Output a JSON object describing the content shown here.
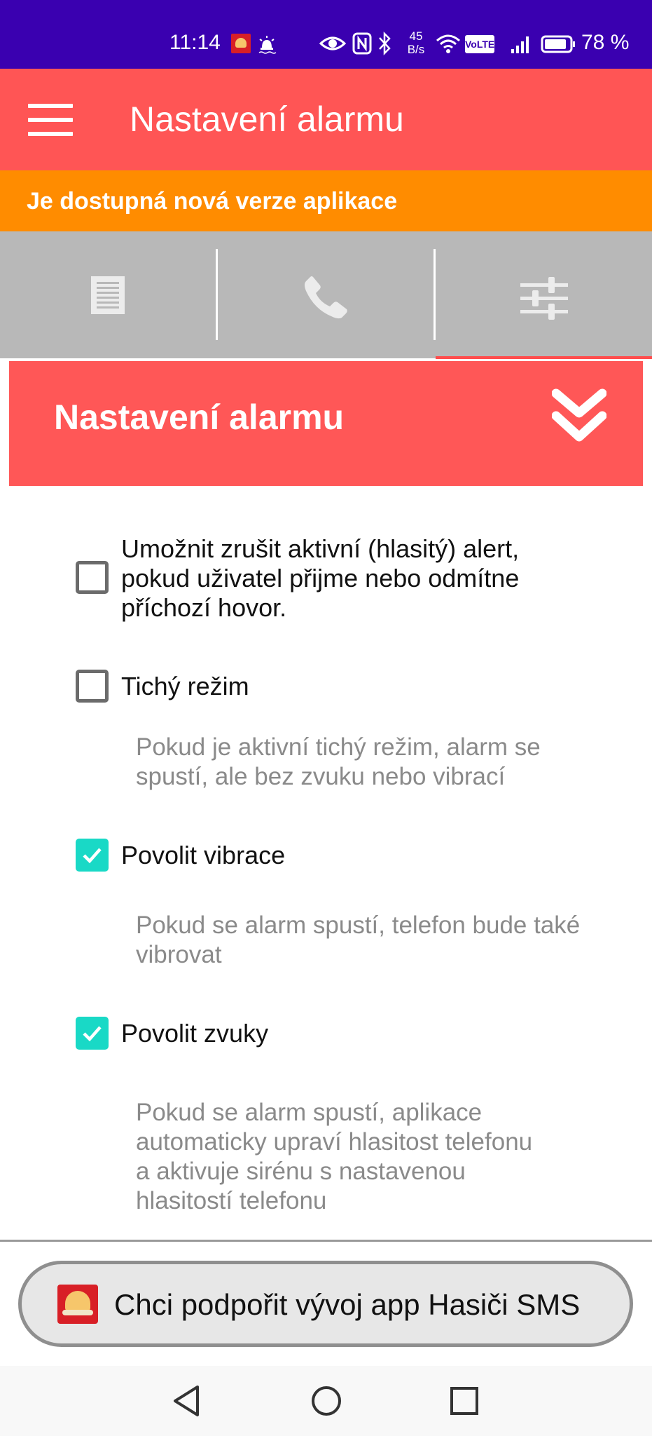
{
  "status_bar": {
    "time": "11:14",
    "net_speed_value": "45",
    "net_speed_unit": "B/s",
    "volte": "VoLTE",
    "battery_percent": "78 %",
    "icons": [
      "app-notification-icon",
      "alarm-icon",
      "eye-icon",
      "nfc-icon",
      "bluetooth-icon",
      "wifi-icon",
      "volte-icon",
      "signal-icon",
      "battery-icon"
    ]
  },
  "app_bar": {
    "title": "Nastavení alarmu",
    "menu_icon": "hamburger-menu-icon"
  },
  "update_banner": {
    "text": "Je dostupná nová verze aplikace"
  },
  "tabs": [
    {
      "icon": "list-icon",
      "selected": false
    },
    {
      "icon": "phone-icon",
      "selected": false
    },
    {
      "icon": "sliders-icon",
      "selected": true
    }
  ],
  "section": {
    "title": "Nastavení alarmu",
    "toggle_icon": "double-chevron-down-icon"
  },
  "settings": [
    {
      "label_lines": [
        "Umožnit zrušit aktivní (hlasitý) alert,",
        "pokud uživatel přijme nebo odmítne",
        "příchozí hovor."
      ],
      "checked": false
    },
    {
      "label": "Tichý režim",
      "description_lines": [
        "Pokud je aktivní tichý režim, alarm se",
        "spustí, ale bez zvuku nebo vibrací"
      ],
      "checked": false
    },
    {
      "label": "Povolit vibrace",
      "description_lines": [
        "Pokud se alarm spustí, telefon bude také",
        "vibrovat"
      ],
      "checked": true
    },
    {
      "label": "Povolit zvuky",
      "description_lines": [
        "Pokud se alarm spustí, aplikace",
        "automaticky upraví hlasitost telefonu",
        "a aktivuje sirénu s nastavenou",
        "hlasitostí telefonu"
      ],
      "checked": true
    }
  ],
  "support_button": {
    "label": "Chci podpořit vývoj app Hasiči SMS"
  },
  "nav_bar": [
    "back-icon",
    "home-icon",
    "recents-icon"
  ],
  "colors": {
    "status_bar": "#3a00b0",
    "app_bar": "#ff5555",
    "banner": "#ff8c00",
    "tabs": "#b8b8b8",
    "checkbox_checked": "#19d9c6"
  }
}
